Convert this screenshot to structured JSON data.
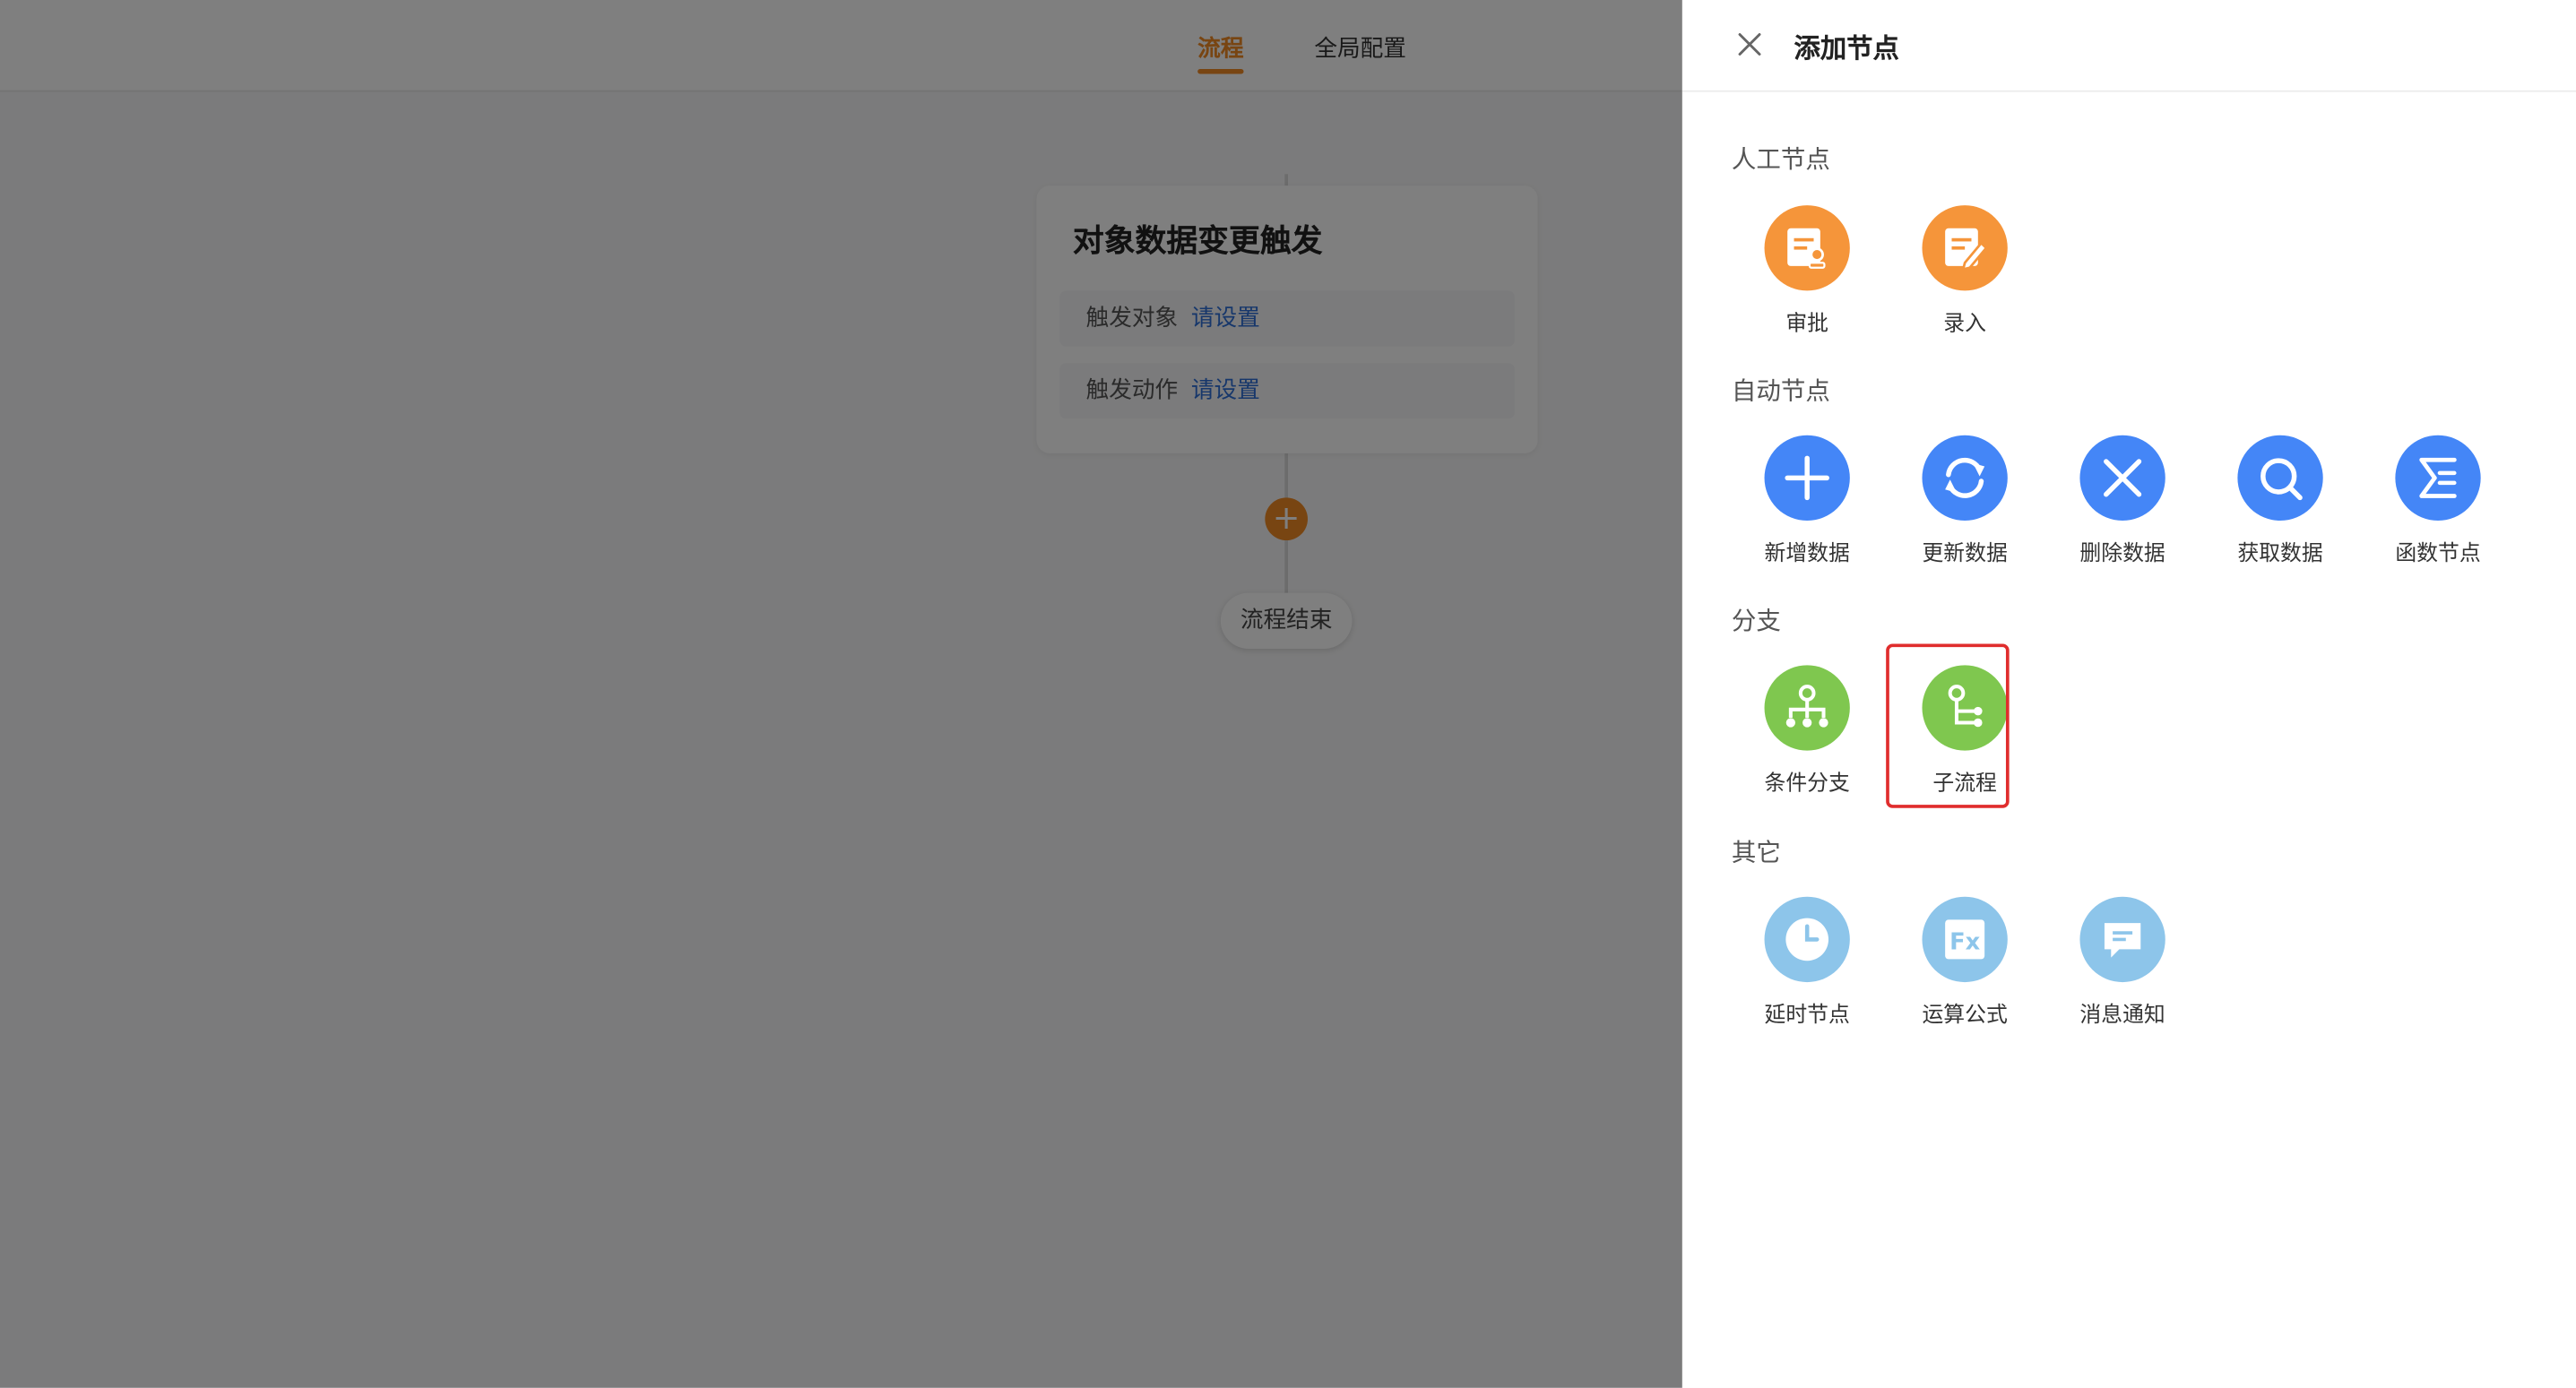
{
  "topbar": {
    "tabs": [
      {
        "label": "流程",
        "active": true
      },
      {
        "label": "全局配置",
        "active": false
      }
    ]
  },
  "flow": {
    "trigger_title": "对象数据变更触发",
    "rows": [
      {
        "label": "触发对象",
        "link": "请设置"
      },
      {
        "label": "触发动作",
        "link": "请设置"
      }
    ],
    "add_symbol": "+",
    "end_label": "流程结束"
  },
  "drawer": {
    "title": "添加节点",
    "sections": [
      {
        "title": "人工节点",
        "nodes": [
          {
            "label": "审批",
            "icon": "approval-icon",
            "color": "#f5953a"
          },
          {
            "label": "录入",
            "icon": "form-entry-icon",
            "color": "#f5953a"
          }
        ]
      },
      {
        "title": "自动节点",
        "nodes": [
          {
            "label": "新增数据",
            "icon": "plus-icon",
            "color": "#4486f7"
          },
          {
            "label": "更新数据",
            "icon": "refresh-icon",
            "color": "#4486f7"
          },
          {
            "label": "删除数据",
            "icon": "delete-x-icon",
            "color": "#4486f7"
          },
          {
            "label": "获取数据",
            "icon": "search-icon",
            "color": "#4486f7"
          },
          {
            "label": "函数节点",
            "icon": "sigma-icon",
            "color": "#4486f7"
          }
        ]
      },
      {
        "title": "分支",
        "nodes": [
          {
            "label": "条件分支",
            "icon": "branch-tree-icon",
            "color": "#7fc74f"
          },
          {
            "label": "子流程",
            "icon": "subprocess-icon",
            "color": "#7fc74f",
            "highlighted": true
          }
        ]
      },
      {
        "title": "其它",
        "nodes": [
          {
            "label": "延时节点",
            "icon": "clock-icon",
            "color": "#8dc5ea"
          },
          {
            "label": "运算公式",
            "icon": "fx-formula-icon",
            "color": "#8dc5ea"
          },
          {
            "label": "消息通知",
            "icon": "message-icon",
            "color": "#8dc5ea"
          }
        ]
      }
    ]
  }
}
